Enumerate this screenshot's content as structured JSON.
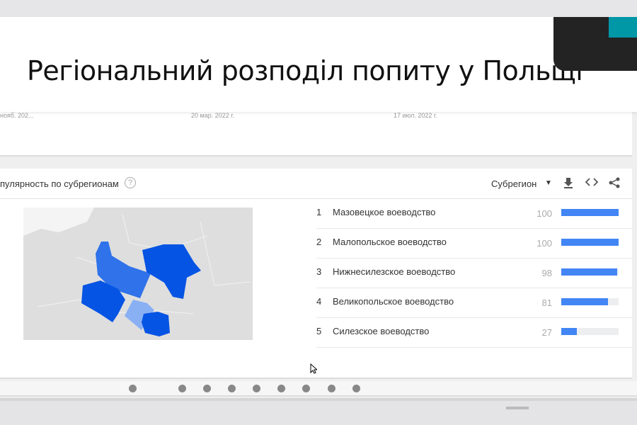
{
  "slide": {
    "title": "Регіональний розподіл попиту у Польщі"
  },
  "timeline": {
    "dates": [
      "нояб. 202...",
      "20 мар. 2022 г.",
      "17 июл. 2022 г."
    ]
  },
  "panel": {
    "title": "пулярность по субрегионам",
    "help": "?",
    "resolution": "Субрегион",
    "icons": [
      "download-icon",
      "embed-icon",
      "share-icon"
    ],
    "rows": [
      {
        "rank": "1",
        "name": "Мазовецкое воеводство",
        "value": 100
      },
      {
        "rank": "2",
        "name": "Малопольское воеводство",
        "value": 100
      },
      {
        "rank": "3",
        "name": "Нижнесилезское воеводство",
        "value": 98
      },
      {
        "rank": "4",
        "name": "Великопольское воеводство",
        "value": 81
      },
      {
        "rank": "5",
        "name": "Силезское воеводство",
        "value": 27
      }
    ]
  },
  "colors": {
    "accent": "#4285f4",
    "map_strong": "#0554e4",
    "map_mid": "#2f72ea",
    "map_light": "#8ab0f4",
    "teal": "#0097a7"
  }
}
